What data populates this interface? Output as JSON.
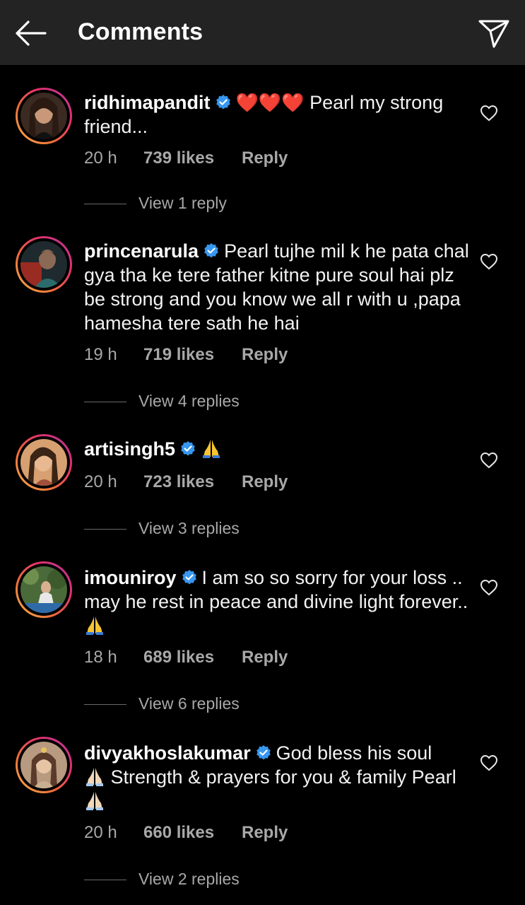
{
  "header": {
    "title": "Comments",
    "back_icon": "arrow-left-icon",
    "share_icon": "paper-plane-icon"
  },
  "comments": [
    {
      "username": "ridhimapandit",
      "text_after": " Pearl my strong friend...",
      "hearts": "❤️❤️❤️",
      "time": "20 h",
      "likes": "739 likes",
      "reply_label": "Reply",
      "view_replies": "View 1 reply"
    },
    {
      "username": "princenarula",
      "text_after": "Pearl tujhe mil k he pata chal gya tha ke tere father kitne pure soul hai plz be strong and you know we all r with u ,papa hamesha tere sath he hai",
      "time": "19 h",
      "likes": "719 likes",
      "reply_label": "Reply",
      "view_replies": "View 4 replies"
    },
    {
      "username": "artisingh5",
      "time": "20 h",
      "likes": "723 likes",
      "reply_label": "Reply",
      "view_replies": "View 3 replies"
    },
    {
      "username": "imouniroy",
      "text_after": "I am so so sorry for your loss .. may he rest in peace and divine light forever..",
      "time": "18 h",
      "likes": "689 likes",
      "reply_label": "Reply",
      "view_replies": "View 6 replies"
    },
    {
      "username": "divyakhoslakumar",
      "text_part1": "God bless his soul",
      "text_part2": " Strength & prayers for you & family Pearl ",
      "time": "20 h",
      "likes": "660 likes",
      "reply_label": "Reply",
      "view_replies": "View 2 replies"
    }
  ],
  "colors": {
    "background": "#000000",
    "header_bg": "#232323",
    "secondary_text": "#a8a8a8",
    "verified_blue": "#3897f0",
    "heart_red": "#e0151b"
  }
}
